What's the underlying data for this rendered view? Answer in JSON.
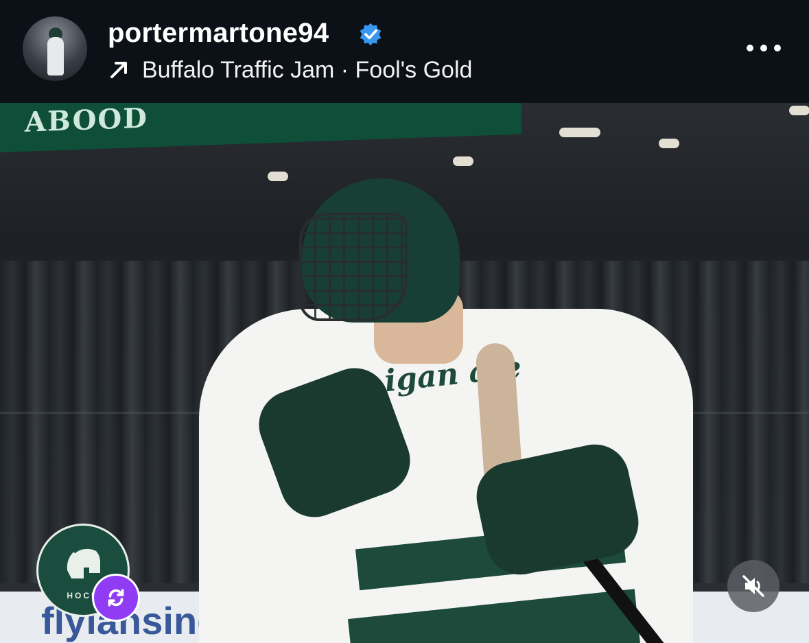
{
  "header": {
    "username": "portermartone94",
    "verified": true,
    "audio_title": "Buffalo Traffic Jam · Fool's Gold",
    "icons": {
      "verified": "verified-badge-icon",
      "audio": "arrow-up-right-icon",
      "more": "more-dots-icon"
    }
  },
  "photo": {
    "banner_text": "ABOOD",
    "board_text": "flylansing.com",
    "jersey_text": "igan ate",
    "team_logo_label": "HOCK"
  },
  "controls": {
    "repost_icon": "repost-icon",
    "mute_icon": "muted-speaker-icon"
  },
  "colors": {
    "header_bg": "#0c1117",
    "verified": "#3897f0",
    "repost": "#8f3cf4",
    "team_green": "#1a4d3d"
  }
}
